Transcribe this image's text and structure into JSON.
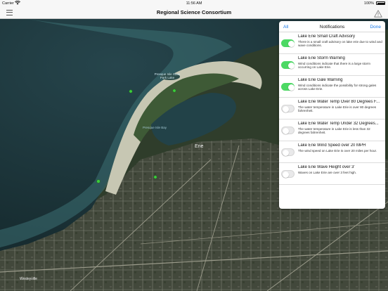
{
  "status_bar": {
    "carrier": "Carrier",
    "wifi_icon": "wifi-icon",
    "time": "11:56 AM",
    "battery_percent": "100%",
    "battery_icon": "battery-icon"
  },
  "nav": {
    "title": "Regional Science Consortium",
    "menu_icon": "hamburger-menu-icon",
    "warning_icon": "warning-triangle-icon"
  },
  "map": {
    "labels": {
      "park_lake": "Presque Isle State Park Lake",
      "bay": "Presque Isle Bay",
      "city": "Erie",
      "town": "Wesleyville"
    }
  },
  "notifications": {
    "all_label": "All",
    "title": "Notifications",
    "done_label": "Done",
    "items": [
      {
        "title": "Lake Erie Small Craft Advisory",
        "description": "There is a small craft advisory on lake erie due to wind and wave conditions.",
        "enabled": true
      },
      {
        "title": "Lake Erie Storm Warning",
        "description": "Wind conditions indicate that there is a large storm occurring on Lake Erie.",
        "enabled": true
      },
      {
        "title": "Lake Erie Gale Warning",
        "description": "Wind conditions indicate the possibility for strong gales across Lake Erie.",
        "enabled": true
      },
      {
        "title": "Lake Erie Water Temp Over 80 Degrees F...",
        "description": "The water temperature in Lake Erie is over 80 degrees fahrenheit.",
        "enabled": false
      },
      {
        "title": "Lake Erie Water Temp Under 32 Degrees...",
        "description": "The water temperature in Lake Erie is less than 32 degrees fahrenheit.",
        "enabled": false
      },
      {
        "title": "Lake Erie Wind Speed over 20 MPH",
        "description": "The wind speed on Lake Erie is over 20 miles per hour.",
        "enabled": false
      },
      {
        "title": "Lake Erie Wave Height over 3'",
        "description": "Waves on Lake Erie are over 3 feet high.",
        "enabled": false
      }
    ]
  },
  "colors": {
    "accent": "#1a7ae8",
    "toggle_on": "#4cd964",
    "toggle_off": "#e9e9ea",
    "lake": "#1f3d44",
    "land": "#3b4a34"
  }
}
